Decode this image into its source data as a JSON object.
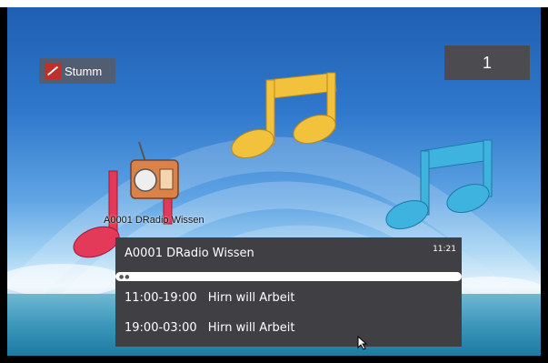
{
  "mute_button": {
    "label": "Stumm",
    "icon": "mute-speaker-icon",
    "color": "#c0302b"
  },
  "channel_number": "1",
  "radio_station_label": "A0001 DRadio Wissen",
  "epg": {
    "channel": "A0001 DRadio Wissen",
    "clock": "11:21",
    "programs": [
      {
        "time": "11:00-19:00",
        "title": "Hirn will Arbeit"
      },
      {
        "time": "19:00-03:00",
        "title": "Hirn will Arbeit"
      }
    ]
  },
  "decor": {
    "note_colors": [
      "#e43a5a",
      "#f2c23c",
      "#3fb3e0"
    ],
    "radio_icon": "radio-icon"
  }
}
